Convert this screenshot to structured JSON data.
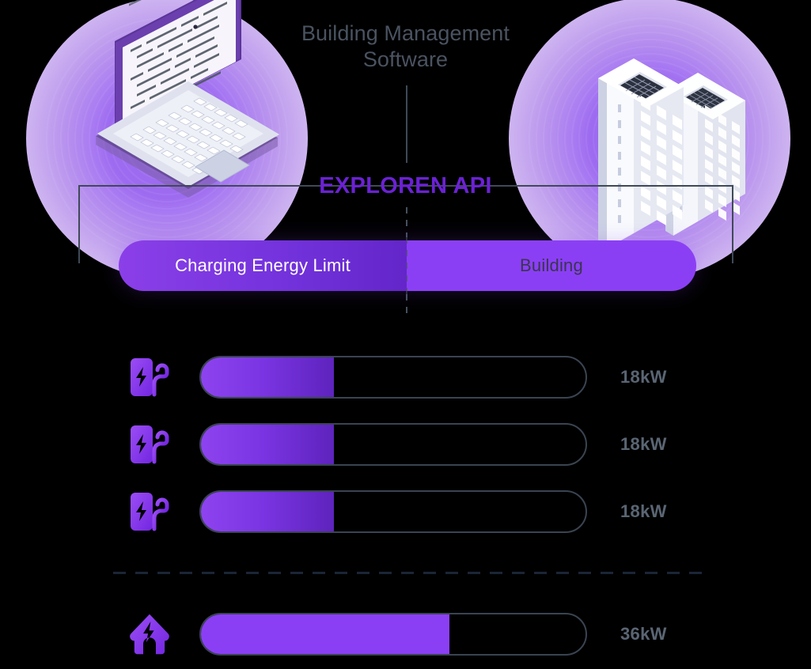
{
  "header": {
    "title": "Building Management Software"
  },
  "api_label": "EXPLOREN API",
  "pill": {
    "left_label": "Charging  Energy Limit",
    "right_label": "Building",
    "left_color": "#7433dd",
    "right_color": "#8b3ff5"
  },
  "illustrations": {
    "left": {
      "name": "isometric-laptop",
      "glow_color": "#9d6bf0"
    },
    "right": {
      "name": "isometric-buildings",
      "glow_color": "#9d6bf0"
    }
  },
  "meters": [
    {
      "icon": "ev-charger-icon",
      "value": "18kW",
      "fill_pct": 33,
      "style": "gradient"
    },
    {
      "icon": "ev-charger-icon",
      "value": "18kW",
      "fill_pct": 33,
      "style": "gradient"
    },
    {
      "icon": "ev-charger-icon",
      "value": "18kW",
      "fill_pct": 33,
      "style": "gradient"
    },
    {
      "icon": "house-bolt-icon",
      "value": "36kW",
      "fill_pct": 65,
      "style": "bright"
    }
  ],
  "colors": {
    "accent": "#8b3ff5",
    "api_text": "#6b21d4",
    "muted_text": "#5a6573",
    "title_text": "#4a5360",
    "track_border": "#3a4451",
    "background": "#000000"
  }
}
